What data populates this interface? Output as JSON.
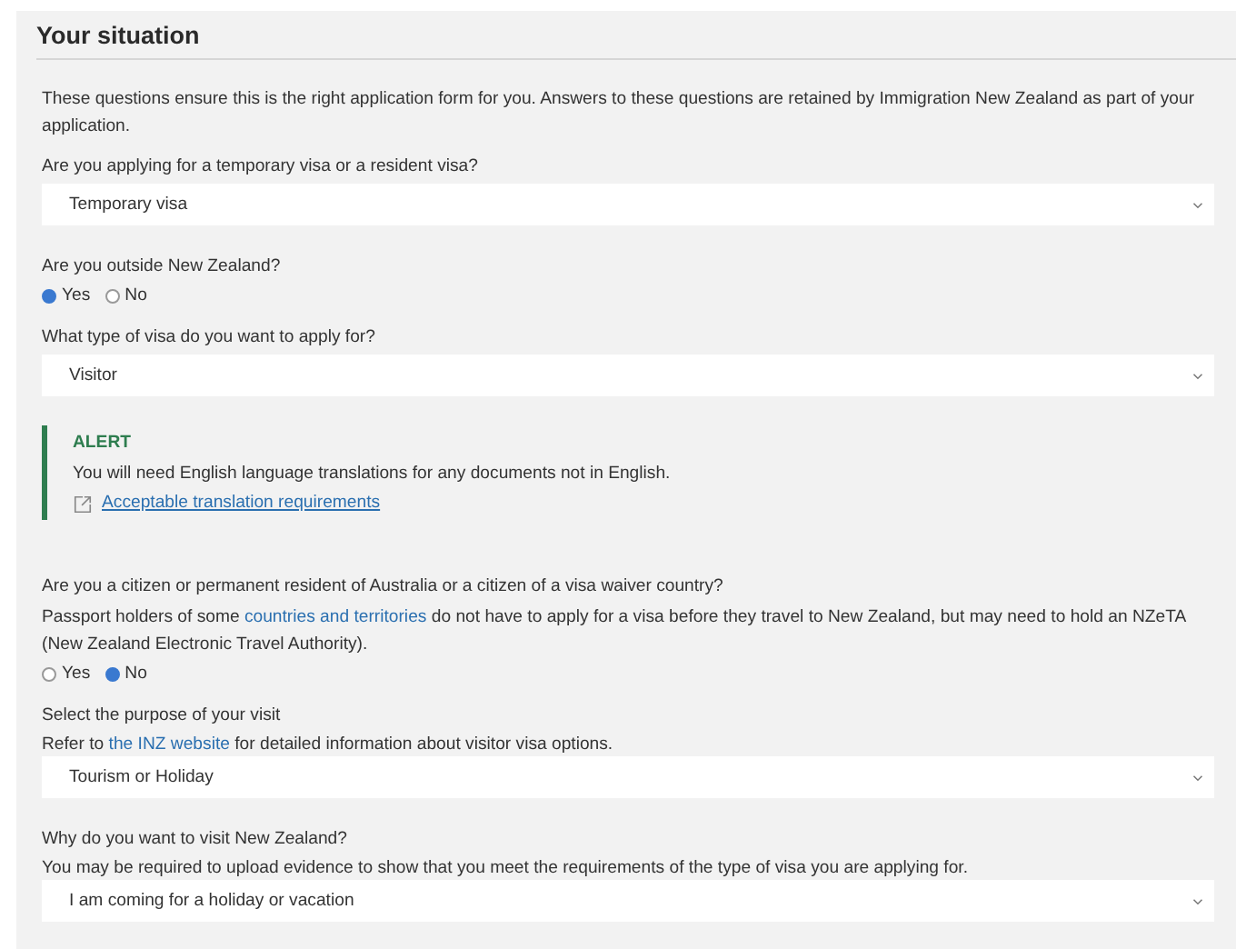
{
  "panel": {
    "title": "Your situation",
    "intro": "These questions ensure this is the right application form for you. Answers to these questions are retained by Immigration New Zealand as part of your application."
  },
  "items": [
    {
      "kind": "select",
      "label": "Are you applying for a temporary visa or a resident visa?",
      "value": "Temporary visa"
    },
    {
      "kind": "radio",
      "label": "Are you outside New Zealand?",
      "options": [
        {
          "label": "Yes",
          "selected": true
        },
        {
          "label": "No",
          "selected": false
        }
      ]
    },
    {
      "kind": "select",
      "label": "What type of visa do you want to apply for?",
      "value": "Visitor"
    },
    {
      "kind": "alert",
      "title": "ALERT",
      "text": "You will need English language translations for any documents not in English.",
      "link": "Acceptable translation requirements"
    },
    {
      "kind": "radio",
      "label": "Are you a citizen or permanent resident of Australia or a citizen of a visa waiver country?",
      "help": [
        {
          "text": "Passport holders of some "
        },
        {
          "text": "countries and territories",
          "link": true
        },
        {
          "text": " do not have to apply for a visa before they travel to New Zealand, but may need to hold an NZeTA (New Zealand Electronic Travel Authority)."
        }
      ],
      "options": [
        {
          "label": "Yes",
          "selected": false
        },
        {
          "label": "No",
          "selected": true
        }
      ]
    },
    {
      "kind": "select",
      "label": "Select the purpose of your visit",
      "help": [
        {
          "text": "Refer to "
        },
        {
          "text": "the INZ website",
          "link": true
        },
        {
          "text": " for detailed information about visitor visa options."
        }
      ],
      "value": "Tourism or Holiday"
    },
    {
      "kind": "select",
      "label": "Why do you want to visit New Zealand?",
      "help": [
        {
          "text": "You may be required to upload evidence to show that you meet the requirements of the type of visa you are applying for."
        }
      ],
      "value": "I am coming for a holiday or vacation"
    }
  ]
}
